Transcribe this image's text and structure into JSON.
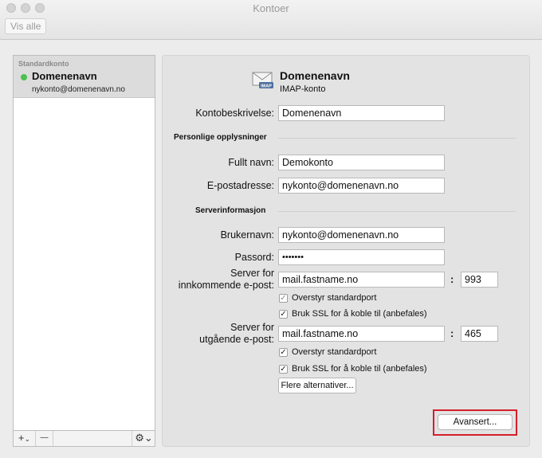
{
  "window": {
    "title": "Kontoer",
    "show_all": "Vis alle"
  },
  "sidebar": {
    "group_label": "Standardkonto",
    "account": {
      "name": "Domenenavn",
      "email": "nykonto@domenenavn.no",
      "status_color": "#4cc24c"
    },
    "toolbar": {
      "add": "+",
      "add_menu": "⌄",
      "remove": "—",
      "gear": "⚙⌄"
    }
  },
  "account": {
    "icon_badge": "IMAP",
    "title": "Domenenavn",
    "type": "IMAP-konto",
    "description_label": "Kontobeskrivelse:",
    "description_value": "Domenenavn",
    "personal_section": "Personlige opplysninger",
    "fullname_label": "Fullt navn:",
    "fullname_value": "Demokonto",
    "email_label": "E-postadresse:",
    "email_value": "nykonto@domenenavn.no",
    "server_section": "Serverinformasjon",
    "username_label": "Brukernavn:",
    "username_value": "nykonto@domenenavn.no",
    "password_label": "Passord:",
    "password_value": "•••••••",
    "incoming_label_1": "Server for",
    "incoming_label_2": "innkommende e-post:",
    "incoming_server": "mail.fastname.no",
    "incoming_port": "993",
    "incoming_override": "Overstyr standardport",
    "incoming_ssl": "Bruk SSL for å koble til (anbefales)",
    "outgoing_label_1": "Server for",
    "outgoing_label_2": "utgående e-post:",
    "outgoing_server": "mail.fastname.no",
    "outgoing_port": "465",
    "outgoing_override": "Overstyr standardport",
    "outgoing_ssl": "Bruk SSL for å koble til (anbefales)",
    "more_options": "Flere alternativer...",
    "advanced": "Avansert...",
    "colon": ":",
    "check": "✓",
    "highlight_color": "#d71e2b"
  }
}
